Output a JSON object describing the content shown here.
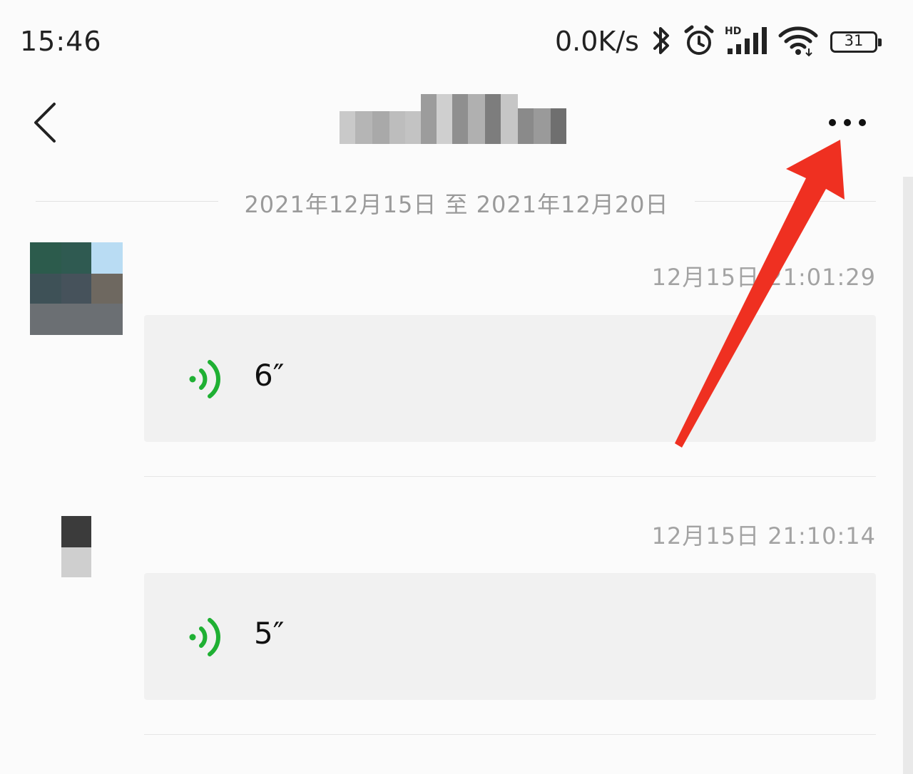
{
  "status_bar": {
    "time": "15:46",
    "net_speed": "0.0K/s",
    "battery": "31",
    "icons": [
      "bluetooth-icon",
      "alarm-icon",
      "hd-signal-icon",
      "wifi-icon",
      "battery-icon"
    ]
  },
  "nav": {
    "back_icon": "chevron-left-icon",
    "title": "",
    "more_icon": "more-dots-icon"
  },
  "history": {
    "date_range": "2021年12月15日 至 2021年12月20日"
  },
  "messages": [
    {
      "timestamp": "12月15日 21:01:29",
      "type": "voice",
      "duration": "6″"
    },
    {
      "timestamp": "12月15日 21:10:14",
      "type": "voice",
      "duration": "5″"
    }
  ],
  "colors": {
    "voice_icon": "#1fb033",
    "annotation_arrow": "#ef3021",
    "bubble_bg": "#f1f1f1",
    "muted_text": "#9a9a9a"
  }
}
